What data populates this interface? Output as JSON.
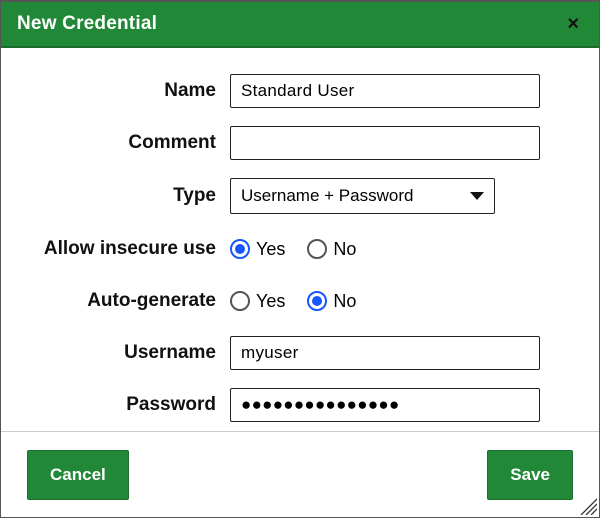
{
  "dialog": {
    "title": "New Credential",
    "labels": {
      "name": "Name",
      "comment": "Comment",
      "type": "Type",
      "allow_insecure": "Allow insecure use",
      "auto_generate": "Auto-generate",
      "username": "Username",
      "password": "Password"
    },
    "values": {
      "name": "Standard User",
      "comment": "",
      "type_selected": "Username + Password",
      "allow_insecure": "yes",
      "auto_generate": "no",
      "username": "myuser",
      "password_masked": "●●●●●●●●●●●●●●●"
    },
    "options": {
      "yes": "Yes",
      "no": "No"
    },
    "buttons": {
      "cancel": "Cancel",
      "save": "Save"
    }
  }
}
